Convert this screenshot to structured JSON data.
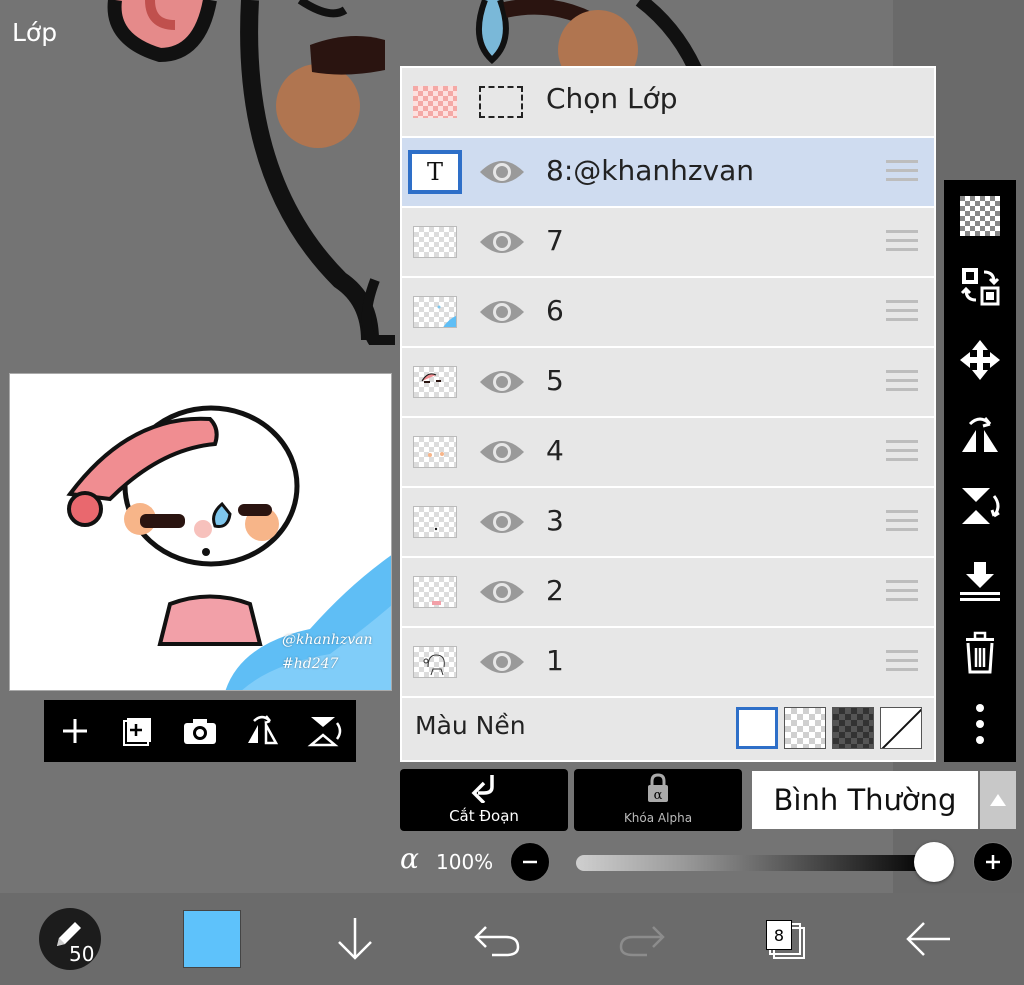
{
  "screen_title": "Lớp",
  "layer_panel": {
    "header_label": "Chọn Lớp",
    "layers": [
      {
        "name": "8:@khanhzvan",
        "selected": true,
        "type": "text",
        "thumb_icon": "T"
      },
      {
        "name": "7",
        "selected": false
      },
      {
        "name": "6",
        "selected": false
      },
      {
        "name": "5",
        "selected": false
      },
      {
        "name": "4",
        "selected": false
      },
      {
        "name": "3",
        "selected": false
      },
      {
        "name": "2",
        "selected": false
      },
      {
        "name": "1",
        "selected": false
      }
    ],
    "background_color_label": "Màu Nền",
    "background_swatches": [
      "white",
      "transparent",
      "dark-checker",
      "none"
    ],
    "selected_background": "white"
  },
  "preview": {
    "watermark_line1": "@khanhzvan",
    "watermark_line2": "#hd247"
  },
  "controls": {
    "clipping_label": "Cắt Đoạn",
    "alpha_lock_label": "Khóa Alpha",
    "blend_mode": "Bình Thường",
    "opacity_symbol": "α",
    "opacity_value": "100%",
    "opacity_fraction": 1.0
  },
  "bottom_bar": {
    "brush_size": "50",
    "current_color": "#5ec2fb",
    "layer_count": "8"
  },
  "side_toolbar_icons": [
    "checker-icon",
    "swap-icon",
    "move-icon",
    "flip-horizontal-icon",
    "flip-vertical-icon",
    "merge-down-icon",
    "trash-icon",
    "more-icon"
  ],
  "mini_toolbar_icons": [
    "add-layer-icon",
    "add-copy-icon",
    "camera-icon",
    "flip-horizontal-icon",
    "flip-vertical-icon"
  ],
  "colors": {
    "accent": "#2e6fc8",
    "selected_row": "#cfdcf0",
    "panel_bg": "#e7e7e7"
  }
}
